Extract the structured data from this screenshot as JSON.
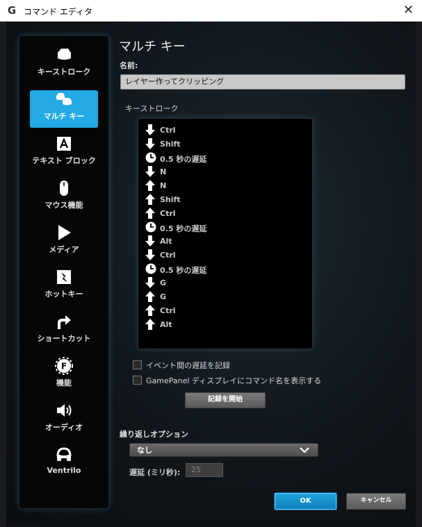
{
  "window": {
    "title": "コマンド エディタ",
    "logo": "G"
  },
  "sidebar": {
    "items": [
      {
        "label": "キーストローク",
        "icon": "key-icon"
      },
      {
        "label": "マルチ キー",
        "icon": "multi-key-icon",
        "active": true
      },
      {
        "label": "テキスト ブロック",
        "icon": "text-block-icon"
      },
      {
        "label": "マウス機能",
        "icon": "mouse-icon"
      },
      {
        "label": "メディア",
        "icon": "play-icon"
      },
      {
        "label": "ホットキー",
        "icon": "hotkey-icon"
      },
      {
        "label": "ショートカット",
        "icon": "shortcut-icon"
      },
      {
        "label": "機能",
        "icon": "function-icon"
      },
      {
        "label": "オーディオ",
        "icon": "speaker-icon"
      },
      {
        "label": "Ventrilo",
        "icon": "headset-icon"
      }
    ]
  },
  "main": {
    "heading": "マルチ キー",
    "name_label": "名前:",
    "name_value": "レイヤー作ってクリッピング",
    "keystroke_label": "キーストローク",
    "keystrokes": [
      {
        "type": "down",
        "text": "Ctrl"
      },
      {
        "type": "down",
        "text": "Shift"
      },
      {
        "type": "delay",
        "text": "0.5 秒の遅延"
      },
      {
        "type": "down",
        "text": "N"
      },
      {
        "type": "up",
        "text": "N"
      },
      {
        "type": "up",
        "text": "Shift"
      },
      {
        "type": "up",
        "text": "Ctrl"
      },
      {
        "type": "delay",
        "text": "0.5 秒の遅延"
      },
      {
        "type": "down",
        "text": "Alt"
      },
      {
        "type": "down",
        "text": "Ctrl"
      },
      {
        "type": "delay",
        "text": "0.5 秒の遅延"
      },
      {
        "type": "down",
        "text": "G"
      },
      {
        "type": "up",
        "text": "G"
      },
      {
        "type": "up",
        "text": "Ctrl"
      },
      {
        "type": "up",
        "text": "Alt"
      }
    ],
    "checkbox_record_delay": "イベント間の遅延を記録",
    "checkbox_gamepanel": "GamePanel ディスプレイにコマンド名を表示する",
    "record_button": "記録を開始",
    "repeat_label": "繰り返しオプション",
    "repeat_selected": "なし",
    "delay_label": "遅延 (ミリ秒):",
    "delay_value": "25",
    "ok_button": "OK",
    "cancel_button": "キャンセル"
  },
  "colors": {
    "accent": "#22a9e6",
    "background": "#10161b"
  }
}
